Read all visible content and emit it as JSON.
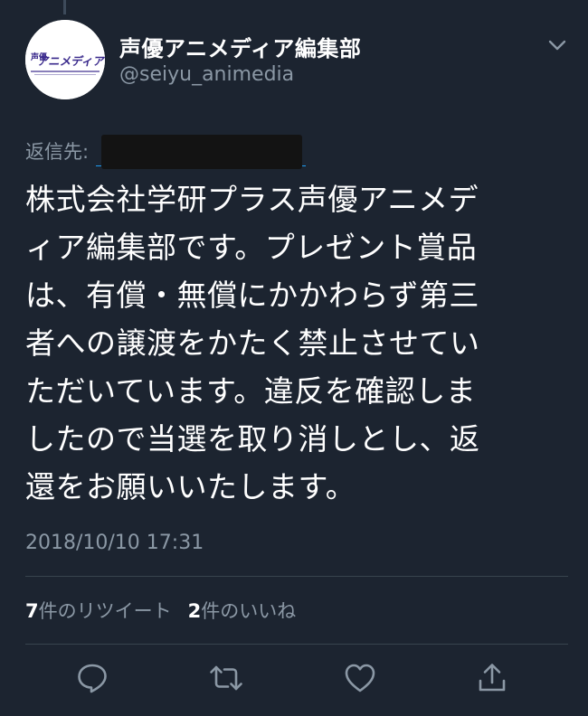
{
  "tweet": {
    "display_name": "声優アニメディア編集部",
    "handle": "@seiyu_animedia",
    "reply_to_label": "返信先:",
    "text_lines": [
      "株式会社学研プラス声優アニメデ",
      "ィア編集部です。プレゼント賞品",
      "は、有償・無償にかかわらず第三",
      "者への譲渡をかたく禁止させてい",
      "ただいています。違反を確認しま",
      "したので当選を取り消しとし、返",
      "還をお願いいたします。"
    ],
    "timestamp": "2018/10/10 17:31",
    "stats": {
      "retweet_count": "7",
      "retweet_label": "件のリツイート",
      "like_count": "2",
      "like_label": "件のいいね"
    }
  },
  "avatar": {
    "logo_text_top": "声優",
    "logo_text_main": "アニメディア"
  },
  "icons": {
    "menu": "chevron-down-icon",
    "reply": "reply-icon",
    "retweet": "retweet-icon",
    "like": "heart-icon",
    "share": "share-icon"
  },
  "colors": {
    "background": "#1c2430",
    "text_primary": "#ffffff",
    "text_secondary": "#8b98a5",
    "divider": "#38444d",
    "link": "#1d9bf0",
    "logo": "#3a2a8c"
  }
}
